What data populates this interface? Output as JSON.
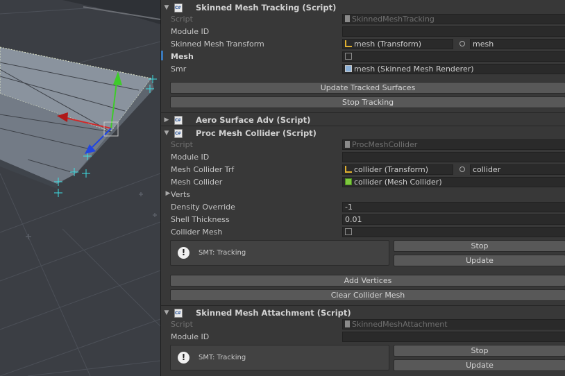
{
  "panels": [
    {
      "title": "Skinned Mesh Tracking (Script)",
      "fields": {
        "script_label": "Script",
        "script_value": "SkinnedMeshTracking",
        "module_id_label": "Module ID",
        "module_id_value": "",
        "transform_label": "Skinned Mesh Transform",
        "transform_value": "mesh (Transform)",
        "transform_value2": "mesh",
        "mesh_label": "Mesh",
        "mesh_value": "",
        "smr_label": "Smr",
        "smr_value": "mesh (Skinned Mesh Renderer)"
      },
      "buttons": [
        "Update Tracked Surfaces",
        "Stop Tracking"
      ]
    },
    {
      "title": "Aero Surface Adv (Script)"
    },
    {
      "title": "Proc Mesh Collider (Script)",
      "fields": {
        "script_label": "Script",
        "script_value": "ProcMeshCollider",
        "module_id_label": "Module ID",
        "module_id_value": "",
        "trf_label": "Mesh Collider Trf",
        "trf_value": "collider (Transform)",
        "trf_value2": "collider",
        "collider_label": "Mesh Collider",
        "collider_value": "collider (Mesh Collider)",
        "verts_label": "Verts",
        "density_label": "Density Override",
        "density_value": "-1",
        "shell_label": "Shell Thickness",
        "shell_value": "0.01",
        "collider_mesh_label": "Collider Mesh",
        "collider_mesh_value": ""
      },
      "help": "SMT: Tracking",
      "side_buttons": [
        "Stop",
        "Update"
      ],
      "buttons": [
        "Add Vertices",
        "Clear Collider Mesh"
      ]
    },
    {
      "title": "Skinned Mesh Attachment (Script)",
      "fields": {
        "script_label": "Script",
        "script_value": "SkinnedMeshAttachment",
        "module_id_label": "Module ID",
        "module_id_value": ""
      },
      "help": "SMT: Tracking",
      "side_buttons": [
        "Stop",
        "Update"
      ]
    }
  ],
  "icons": {
    "script": "csharp-script-icon",
    "transform": "transform-icon",
    "mesh": "mesh-filter-icon",
    "renderer": "skinned-mesh-renderer-icon",
    "collider": "mesh-collider-icon",
    "warning": "warning-icon",
    "picker": "object-picker-icon"
  },
  "colors": {
    "inspector_bg": "#383838",
    "field_bg": "#2a2a2a",
    "button_bg": "#585858",
    "scene_bg": "#3b3e44",
    "gizmo_y": "#3ecb2a",
    "gizmo_x": "#d22a2a",
    "gizmo_z": "#2246e0"
  }
}
